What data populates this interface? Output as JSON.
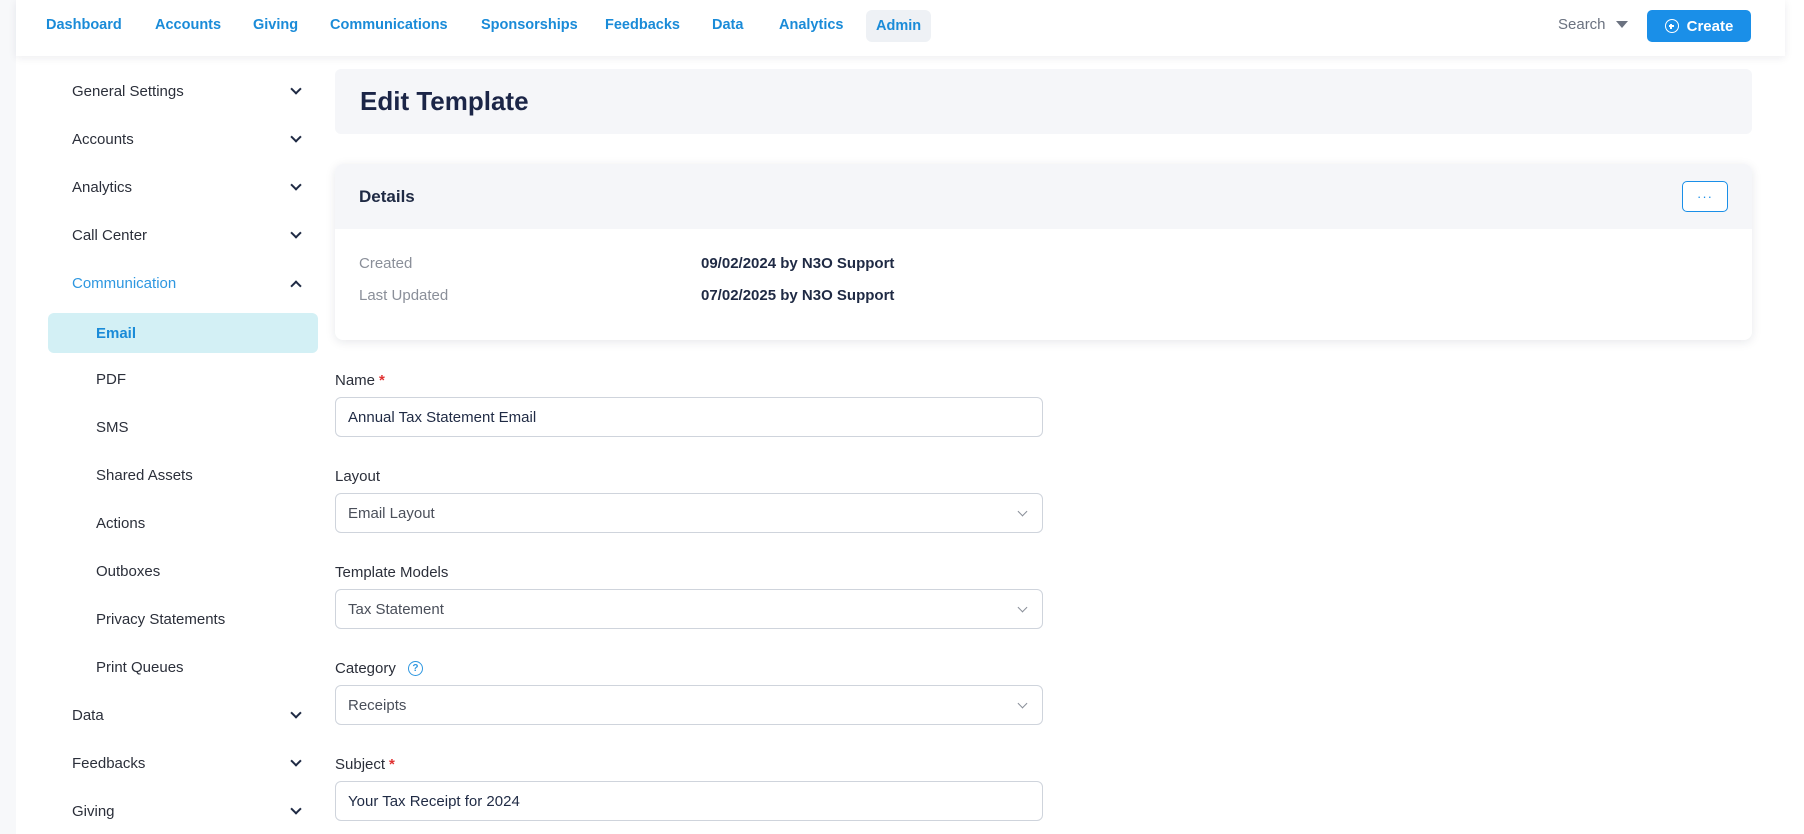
{
  "topnav": {
    "items": [
      "Dashboard",
      "Accounts",
      "Giving",
      "Communications",
      "Sponsorships",
      "Feedbacks",
      "Data",
      "Analytics",
      "Admin"
    ],
    "search_label": "Search",
    "create_label": "Create"
  },
  "sidebar": {
    "items": [
      "General Settings",
      "Accounts",
      "Analytics",
      "Call Center",
      "Communication",
      "Data",
      "Feedbacks",
      "Giving"
    ],
    "communication_sub": [
      "Email",
      "PDF",
      "SMS",
      "Shared Assets",
      "Actions",
      "Outboxes",
      "Privacy Statements",
      "Print Queues"
    ]
  },
  "page": {
    "title": "Edit Template"
  },
  "details": {
    "title": "Details",
    "menu_label": "···",
    "created_label": "Created",
    "created_value": "09/02/2024 by N3O Support",
    "updated_label": "Last Updated",
    "updated_value": "07/02/2025 by N3O Support"
  },
  "form": {
    "name_label": "Name",
    "name_value": "Annual Tax Statement Email",
    "layout_label": "Layout",
    "layout_value": "Email Layout",
    "models_label": "Template Models",
    "models_value": "Tax Statement",
    "category_label": "Category",
    "category_value": "Receipts",
    "subject_label": "Subject",
    "subject_value": "Your Tax Receipt for 2024",
    "required_mark": "*",
    "help_glyph": "?"
  }
}
